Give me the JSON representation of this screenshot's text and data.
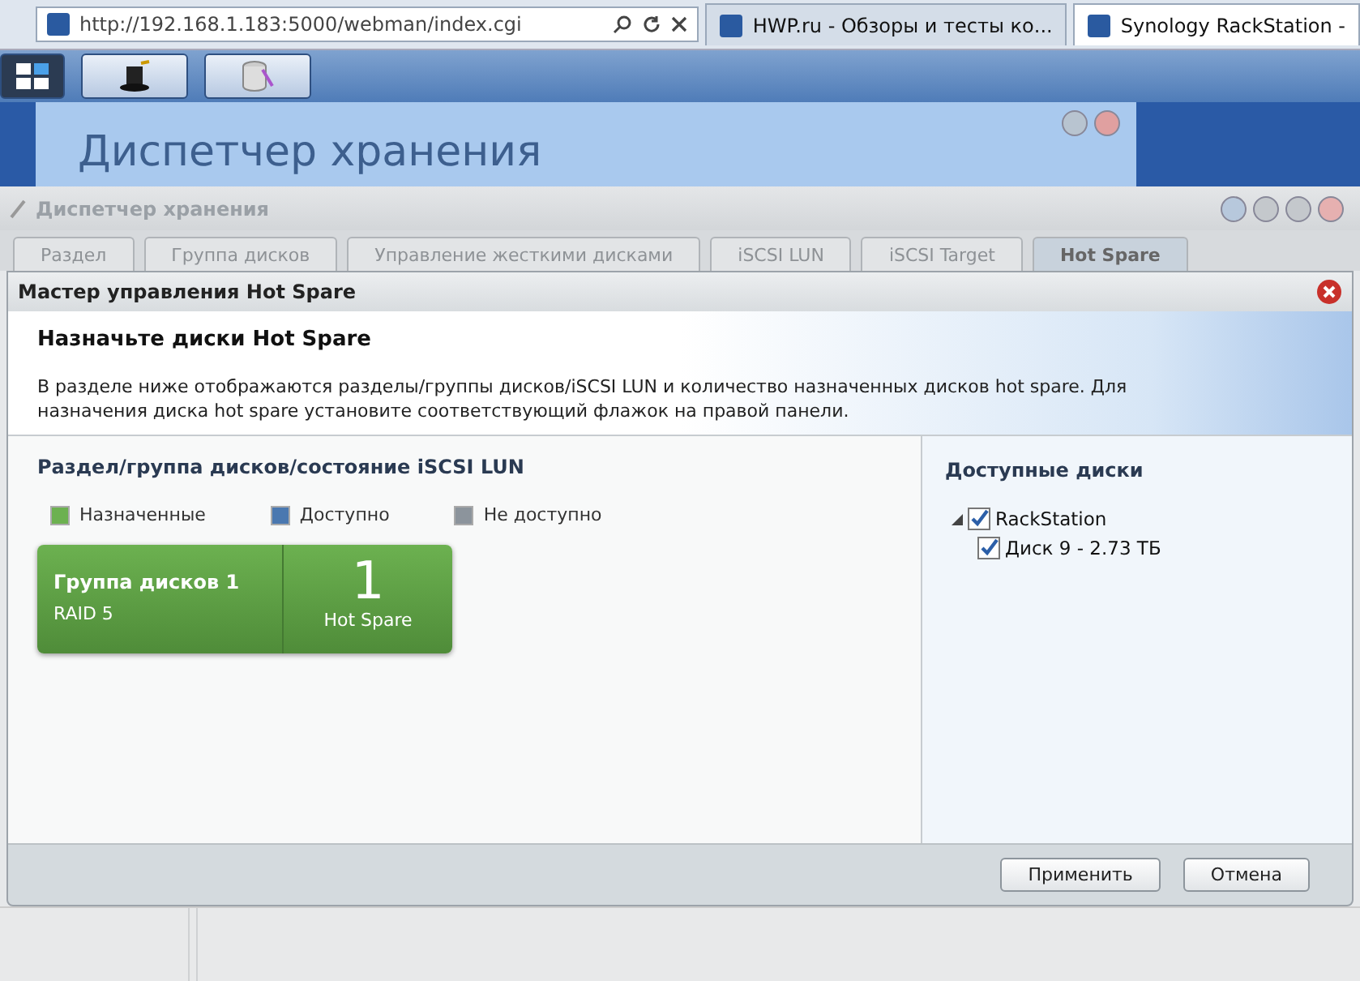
{
  "browser": {
    "address": "http://192.168.1.183:5000/webman/index.cgi",
    "tabs": [
      {
        "title": "HWP.ru - Обзоры и тесты ко...",
        "selected": false
      },
      {
        "title": "Synology RackStation -",
        "selected": true
      }
    ]
  },
  "background_window": {
    "title": "Диспетчер хранения"
  },
  "storage_manager": {
    "title": "Диспетчер хранения",
    "tabs": [
      {
        "label": "Раздел",
        "selected": false
      },
      {
        "label": "Группа дисков",
        "selected": false
      },
      {
        "label": "Управление жесткими дисками",
        "selected": false
      },
      {
        "label": "iSCSI LUN",
        "selected": false
      },
      {
        "label": "iSCSI Target",
        "selected": false
      },
      {
        "label": "Hot Spare",
        "selected": true
      }
    ]
  },
  "dialog": {
    "title": "Мастер управления Hot Spare",
    "heading": "Назначьте диски Hot Spare",
    "description": "В разделе ниже отображаются разделы/группы дисков/iSCSI LUN и количество назначенных дисков hot spare. Для назначения диска hot spare установите соответствующий флажок на правой панели.",
    "left_panel": {
      "title": "Раздел/группа дисков/состояние iSCSI LUN",
      "legend": [
        {
          "label": "Назначенные",
          "color": "#6cb150"
        },
        {
          "label": "Доступно",
          "color": "#4a78b0"
        },
        {
          "label": "Не доступно",
          "color": "#8c949c"
        }
      ],
      "volumes": [
        {
          "name": "Группа дисков 1",
          "raid": "RAID 5",
          "count": "1",
          "count_label": "Hot Spare",
          "color": "#6cb150"
        }
      ]
    },
    "right_panel": {
      "title": "Доступные диски",
      "tree": [
        {
          "label": "RackStation",
          "checked": true,
          "expanded": true,
          "children": [
            {
              "label": "Диск 9 - 2.73 ТБ",
              "checked": true
            }
          ]
        }
      ]
    },
    "buttons": [
      "Применить",
      "Отмена"
    ]
  }
}
